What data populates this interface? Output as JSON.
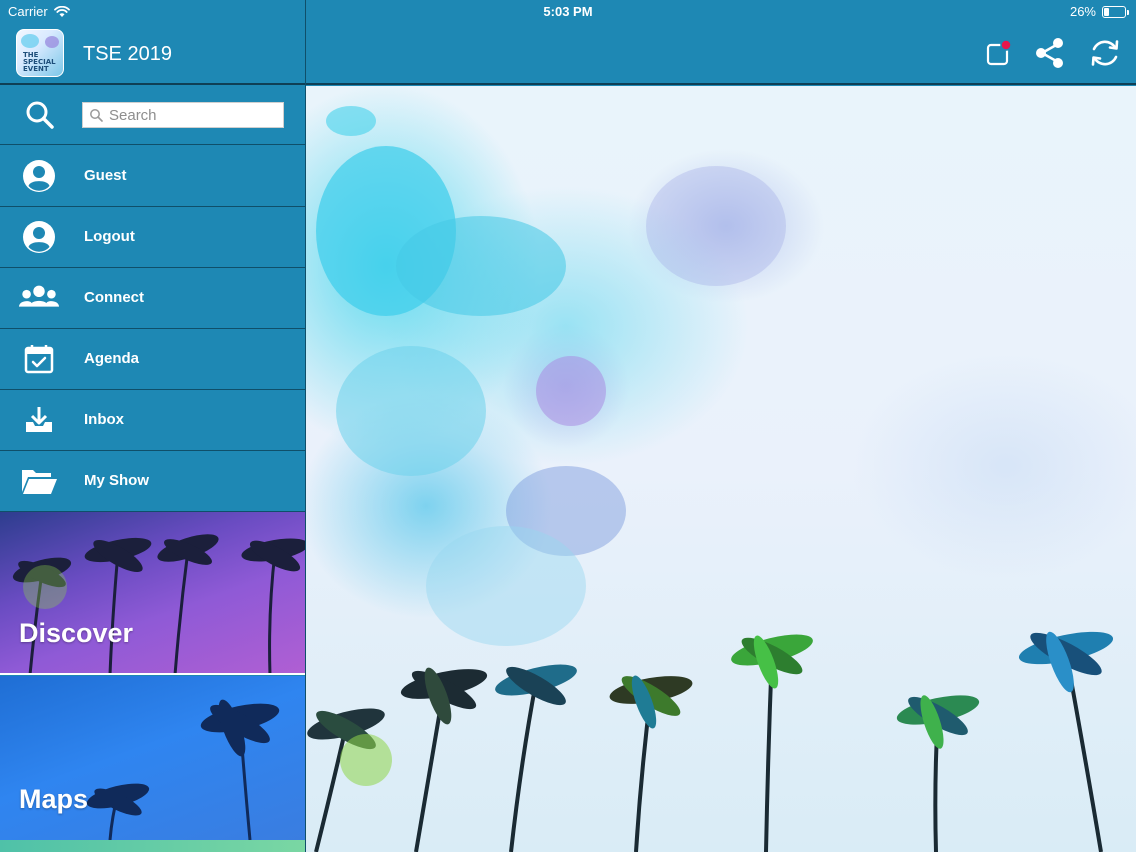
{
  "status_bar": {
    "carrier": "Carrier",
    "time": "5:03 PM",
    "battery_percent": "26%",
    "battery_level": 0.26
  },
  "app": {
    "title": "TSE 2019",
    "logo_text": "THE SPECIAL EVENT"
  },
  "search": {
    "placeholder": "Search",
    "value": ""
  },
  "menu": {
    "items": [
      {
        "label": "Guest",
        "icon": "user-circle-icon"
      },
      {
        "label": "Logout",
        "icon": "user-circle-icon"
      },
      {
        "label": "Connect",
        "icon": "people-group-icon"
      },
      {
        "label": "Agenda",
        "icon": "calendar-check-icon"
      },
      {
        "label": "Inbox",
        "icon": "inbox-download-icon"
      },
      {
        "label": "My Show",
        "icon": "folder-open-icon"
      }
    ]
  },
  "tiles": [
    {
      "label": "Discover"
    },
    {
      "label": "Maps"
    }
  ],
  "toolbar": {
    "buttons": [
      "notification-icon",
      "share-icon",
      "refresh-icon"
    ],
    "notification_dot_color": "#e8174b"
  },
  "colors": {
    "primary": "#1e88b4",
    "divider": "#0f4f6a",
    "text": "#ffffff"
  }
}
